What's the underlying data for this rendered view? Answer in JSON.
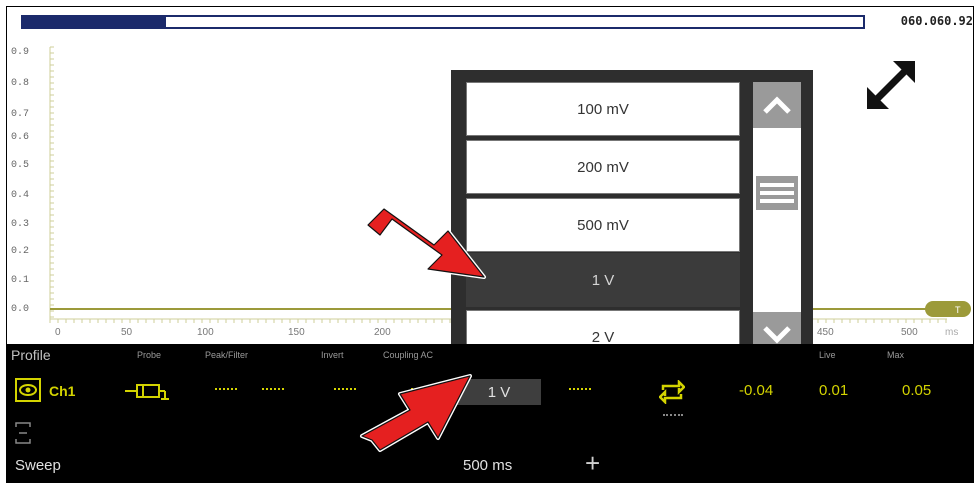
{
  "header": {
    "top_info": "060.060.92",
    "progress": 0.17
  },
  "plot": {
    "y_ticks": [
      "0.9",
      "0.8",
      "0.7",
      "0.6",
      "0.5",
      "0.4",
      "0.3",
      "0.2",
      "0.1",
      "0.0"
    ],
    "x_ticks": [
      "0",
      "50",
      "100",
      "150",
      "200",
      "450",
      "500"
    ],
    "x_unit": "ms",
    "trace_color": "#9c9a3a",
    "trigger_marker": "T"
  },
  "dropdown": {
    "options": [
      "100 mV",
      "200 mV",
      "500 mV",
      "1 V",
      "2 V"
    ],
    "selected": "1 V"
  },
  "panel": {
    "profile_label": "Profile",
    "headers": [
      "Probe",
      "Peak/Filter",
      "Invert",
      "Coupling AC",
      "Live",
      "Max"
    ],
    "channel": "Ch1",
    "scale_value": "1 V",
    "min_value": "-0.04",
    "live_value": "0.01",
    "max_value": "0.05",
    "sweep_label": "Sweep",
    "sweep_value": "500 ms",
    "plus_label": "+"
  },
  "colors": {
    "accent": "#d4d400",
    "annotation_arrow": "#e52020",
    "dark_bar": "#1b2a6b"
  }
}
